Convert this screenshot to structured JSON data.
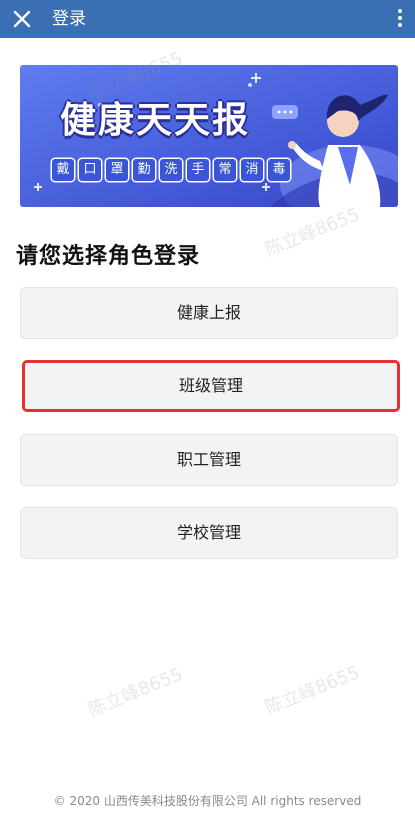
{
  "topbar": {
    "title": "登录",
    "close_icon": "close-icon",
    "more_icon": "more-vertical-icon",
    "color": "#3a6fb4"
  },
  "banner": {
    "title": "健康天天报",
    "slogan": [
      "戴",
      "口",
      "罩",
      "勤",
      "洗",
      "手",
      "常",
      "消",
      "毒"
    ]
  },
  "heading": "请您选择角色登录",
  "roles": [
    {
      "label": "健康上报"
    },
    {
      "label": "班级管理",
      "selected": true
    },
    {
      "label": "职工管理"
    },
    {
      "label": "学校管理"
    }
  ],
  "watermark": "陈立峰8655",
  "footer": "© 2020 山西传美科技股份有限公司 All rights reserved",
  "colors": {
    "accent": "#3a6fb4",
    "selected_border": "#e8302d",
    "button_bg": "#f2f3f4"
  }
}
